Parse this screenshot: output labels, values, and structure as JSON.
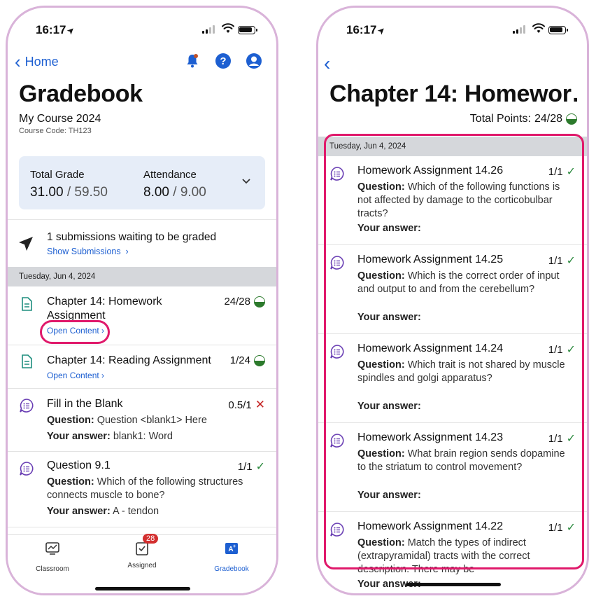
{
  "status": {
    "time": "16:17"
  },
  "left": {
    "nav": {
      "back_label": "Home"
    },
    "title": "Gradebook",
    "course": {
      "name": "My Course 2024",
      "code_label": "Course Code:",
      "code": "TH123"
    },
    "grade_card": {
      "total_label": "Total Grade",
      "total_value": "31.00",
      "total_max": "59.50",
      "attendance_label": "Attendance",
      "attendance_value": "8.00",
      "attendance_max": "9.00",
      "sep": "/"
    },
    "submissions": {
      "text": "1 submissions waiting to be graded",
      "link": "Show Submissions"
    },
    "date": "Tuesday, Jun 4, 2024",
    "items": [
      {
        "title": "Chapter 14: Homework Assignment",
        "score": "24/28",
        "link": "Open Content"
      },
      {
        "title": "Chapter 14: Reading Assignment",
        "score": "1/24",
        "link": "Open Content"
      },
      {
        "title": "Fill in the Blank",
        "score": "0.5/1",
        "question_label": "Question:",
        "question": "Question <blank1> Here",
        "answer_label": "Your answer:",
        "answer": "blank1: Word"
      },
      {
        "title": "Question 9.1",
        "score": "1/1",
        "question_label": "Question:",
        "question": "Which of the following structures connects muscle to bone?",
        "answer_label": "Your answer:",
        "answer": "A - tendon"
      }
    ],
    "tabs": [
      {
        "label": "Classroom"
      },
      {
        "label": "Assigned",
        "badge": "28"
      },
      {
        "label": "Gradebook"
      }
    ]
  },
  "right": {
    "title": "Chapter 14: Homewor…",
    "total_points_label": "Total Points:",
    "total_points": "24/28",
    "date": "Tuesday, Jun 4, 2024",
    "items": [
      {
        "title": "Homework Assignment 14.26",
        "score": "1/1",
        "question_label": "Question:",
        "question": "Which of the following functions is not affected by damage to the corticobulbar tracts?",
        "answer_label": "Your answer:"
      },
      {
        "title": "Homework Assignment 14.25",
        "score": "1/1",
        "question_label": "Question:",
        "question": "Which is the correct order of input and output to and from the cerebellum?",
        "answer_label": "Your answer:"
      },
      {
        "title": "Homework Assignment 14.24",
        "score": "1/1",
        "question_label": "Question:",
        "question": "Which trait is not shared by muscle spindles and golgi apparatus?",
        "answer_label": "Your answer:"
      },
      {
        "title": "Homework Assignment 14.23",
        "score": "1/1",
        "question_label": "Question:",
        "question": "What brain region sends dopamine to the striatum to control movement?",
        "answer_label": "Your answer:"
      },
      {
        "title": "Homework Assignment 14.22",
        "score": "1/1",
        "question_label": "Question:",
        "question": "Match the types of indirect (extrapyramidal) tracts with the correct description. There may be",
        "answer_label": "Your answer:"
      }
    ]
  },
  "colors": {
    "accent": "#1d5fd1",
    "highlight": "#e0196b",
    "success": "#2b8a3e",
    "error": "#c62828",
    "card_bg": "#e6edf8"
  }
}
